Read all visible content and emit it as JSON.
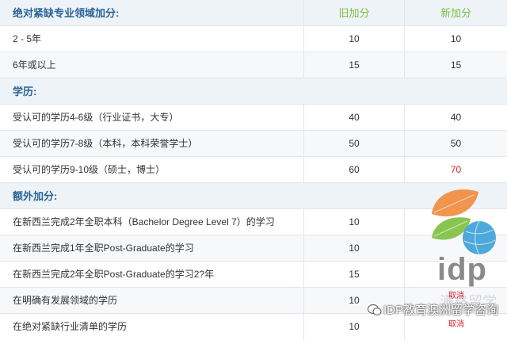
{
  "header": {
    "section_label": "绝对紧缺专业领域加分:",
    "old_label": "旧加分",
    "new_label": "新加分"
  },
  "rows": [
    {
      "label": "2 - 5年",
      "old": "10",
      "new": "10"
    },
    {
      "label": "6年或以上",
      "old": "15",
      "new": "15"
    },
    {
      "section": "学历:"
    },
    {
      "label": "受认可的学历4-6级（行业证书，大专）",
      "old": "40",
      "new": "40"
    },
    {
      "label": "受认可的学历7-8级（本科，本科荣誉学士）",
      "old": "50",
      "new": "50"
    },
    {
      "label": "受认可的学历9-10级（硕士，博士）",
      "old": "60",
      "new": "70"
    },
    {
      "section": "额外加分:"
    },
    {
      "label": "在新西兰完成2年全职本科（Bachelor Degree Level 7）的学习",
      "old": "10",
      "new": ""
    },
    {
      "label": "在新西兰完成1年全职Post-Graduate的学习",
      "old": "10",
      "new": ""
    },
    {
      "label": "在新西兰完成2年全职Post-Graduate的学习2?年",
      "old": "15",
      "new": ""
    },
    {
      "label": "在明确有发展领域的学历",
      "old": "10",
      "new": "取消"
    },
    {
      "label": "在绝对紧缺行业清单的学历",
      "old": "10",
      "new": "取消"
    }
  ],
  "watermark": {
    "brand": "idp",
    "ghost_text": "满格留学",
    "caption": "IDP教育澳洲留学咨询",
    "colors": {
      "orange": "#f08a3c",
      "green": "#7cbf3f",
      "blue": "#3aa0d8",
      "gray": "#8a8a8a"
    }
  },
  "colors": {
    "section_bg": "#eef3f8",
    "section_text": "#2a6496",
    "header_new_old": "#7cbf3f",
    "highlight": "#d9232d"
  }
}
